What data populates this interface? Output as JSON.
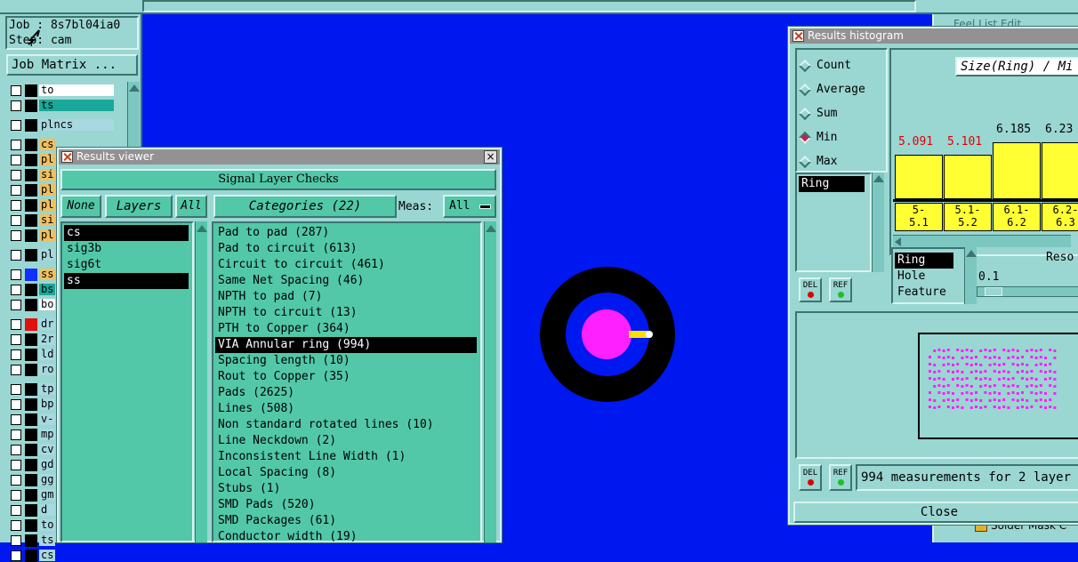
{
  "left_panel": {
    "job_label": "Job : 8s7bl04ia0",
    "step_label": "Step: cam",
    "job_matrix_button": "Job Matrix ...",
    "layers": [
      {
        "name": "to",
        "color": "#ffffff"
      },
      {
        "name": "ts",
        "color": "#1aa89a"
      },
      {
        "name": "plncs",
        "color": "#a8d8e0"
      },
      {
        "name": "cs",
        "color": "#f0c060"
      },
      {
        "name": "pl",
        "color": "#f0c060"
      },
      {
        "name": "si",
        "color": "#f0c060"
      },
      {
        "name": "pl",
        "color": "#f0c060"
      },
      {
        "name": "pl",
        "color": "#f0c060"
      },
      {
        "name": "si",
        "color": "#f0c060"
      },
      {
        "name": "pl",
        "color": "#f0c060"
      },
      {
        "name": "pl",
        "color": "#a8d8e0"
      },
      {
        "name": "ss",
        "color": "#f0c060"
      },
      {
        "name": "bs",
        "color": "#1aa89a"
      },
      {
        "name": "bo",
        "color": "#ffffff"
      },
      {
        "name": "dr",
        "color": "#a8d8e0"
      },
      {
        "name": "2r",
        "color": "#a8d8e0"
      },
      {
        "name": "ld",
        "color": "#a8d8e0"
      },
      {
        "name": "ro",
        "color": "#a8d8e0"
      },
      {
        "name": "tp",
        "color": "#a8d8e0"
      },
      {
        "name": "bp",
        "color": "#a8d8e0"
      },
      {
        "name": "v-",
        "color": "#a8d8e0"
      },
      {
        "name": "mp",
        "color": "#a8d8e0"
      },
      {
        "name": "cv",
        "color": "#a8d8e0"
      },
      {
        "name": "gd",
        "color": "#a8d8e0"
      },
      {
        "name": "gg",
        "color": "#a8d8e0"
      },
      {
        "name": "gm",
        "color": "#a8d8e0"
      },
      {
        "name": "d",
        "color": "#a8d8e0"
      },
      {
        "name": "to",
        "color": "#a8d8e0"
      },
      {
        "name": "ts",
        "color": "#a8d8e0"
      },
      {
        "name": "cs",
        "color": "#a8d8e0"
      }
    ]
  },
  "results_viewer": {
    "title": "Results viewer",
    "header": "Signal Layer Checks",
    "none_button": "None",
    "layers_label": "Layers",
    "all_button": "All",
    "categories_label": "Categories (22)",
    "meas_label": "Meas:",
    "meas_value": "All",
    "layers": [
      "cs",
      "sig3b",
      "sig6t",
      "ss"
    ],
    "categories": [
      "Pad to pad (287)",
      "Pad to circuit (613)",
      "Circuit to circuit (461)",
      "Same Net Spacing (46)",
      "NPTH to pad (7)",
      "NPTH to circuit (13)",
      "PTH to Copper (364)",
      "VIA Annular ring (994)",
      "Spacing length (10)",
      "Rout to Copper (35)",
      "Pads (2625)",
      "Lines (508)",
      "Non standard rotated lines (10)",
      "Line Neckdown (2)",
      "Inconsistent Line Width (1)",
      "Local Spacing (8)",
      "Stubs (1)",
      "SMD Pads (520)",
      "SMD Packages (61)",
      "Conductor width (19)"
    ]
  },
  "histogram": {
    "title": "Results histogram",
    "modes": [
      "Count",
      "Average",
      "Sum",
      "Min",
      "Max"
    ],
    "selected_mode": "Min",
    "chart_title": "Size(Ring) / Mi",
    "bars": [
      {
        "value": "5.091",
        "range": "5-\n5.1",
        "highlight": true
      },
      {
        "value": "5.101",
        "range": "5.1-\n5.2",
        "highlight": true
      },
      {
        "value": "6.185",
        "range": "6.1-\n6.2",
        "highlight": false
      },
      {
        "value": "6.23",
        "range": "6.2-\n6.3",
        "highlight": false
      }
    ],
    "list_selected": "Ring",
    "type_list": [
      "Ring",
      "Hole",
      "Feature"
    ],
    "reso_label": "Reso",
    "reso_value": "0.1",
    "del_label": "DEL",
    "ref_label": "REF",
    "status": "994 measurements for 2 layer",
    "close_button": "Close"
  },
  "background_window": {
    "title": "Feel List Edit",
    "bottom_label": "Solder Mask C"
  },
  "colors": {
    "canvas": "#0018f0",
    "panel": "#9ad6d2",
    "teal": "#52c8a8",
    "bar_fill": "#ffff33",
    "highlight_value": "#e00000",
    "ring_outer": "#000000",
    "ring_inner": "#0018f0",
    "pad": "#ff20ff"
  }
}
